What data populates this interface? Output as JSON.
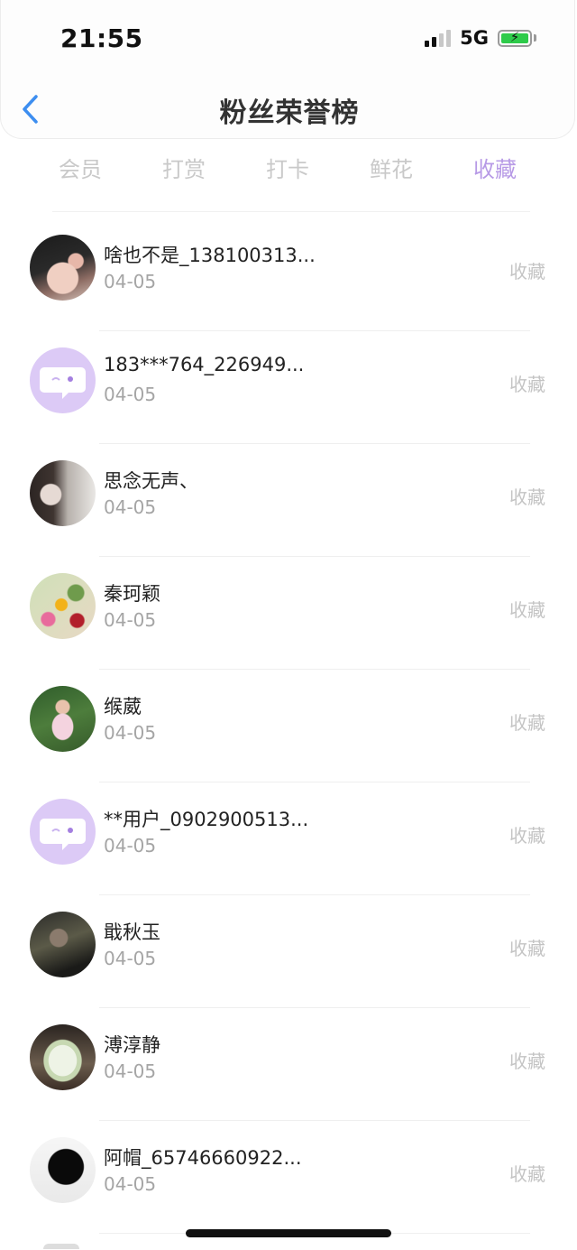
{
  "status_bar": {
    "time": "21:55",
    "network": "5G"
  },
  "header": {
    "title": "粉丝荣誉榜"
  },
  "tabs": [
    {
      "label": "会员",
      "active": false
    },
    {
      "label": "打赏",
      "active": false
    },
    {
      "label": "打卡",
      "active": false
    },
    {
      "label": "鲜花",
      "active": false
    },
    {
      "label": "收藏",
      "active": true
    }
  ],
  "colors": {
    "accent": "#b79ae6",
    "default_avatar_bg": "#dccaf6"
  },
  "fans": [
    {
      "name": "啥也不是_138100313...",
      "date": "04-05",
      "action": "收藏",
      "avatar": "photo-avatar"
    },
    {
      "name": "183***764_226949...",
      "date": "04-05",
      "action": "收藏",
      "avatar": "default-chat-avatar"
    },
    {
      "name": "思念无声、",
      "date": "04-05",
      "action": "收藏",
      "avatar": "photo-avatar"
    },
    {
      "name": "秦珂颖",
      "date": "04-05",
      "action": "收藏",
      "avatar": "photo-avatar"
    },
    {
      "name": "缑葳",
      "date": "04-05",
      "action": "收藏",
      "avatar": "photo-avatar"
    },
    {
      "name": "**用户_0902900513...",
      "date": "04-05",
      "action": "收藏",
      "avatar": "default-chat-avatar"
    },
    {
      "name": "戢秋玉",
      "date": "04-05",
      "action": "收藏",
      "avatar": "photo-avatar"
    },
    {
      "name": "溥淳静",
      "date": "04-05",
      "action": "收藏",
      "avatar": "photo-avatar"
    },
    {
      "name": "阿帽_65746660922...",
      "date": "04-05",
      "action": "收藏",
      "avatar": "photo-avatar"
    }
  ]
}
